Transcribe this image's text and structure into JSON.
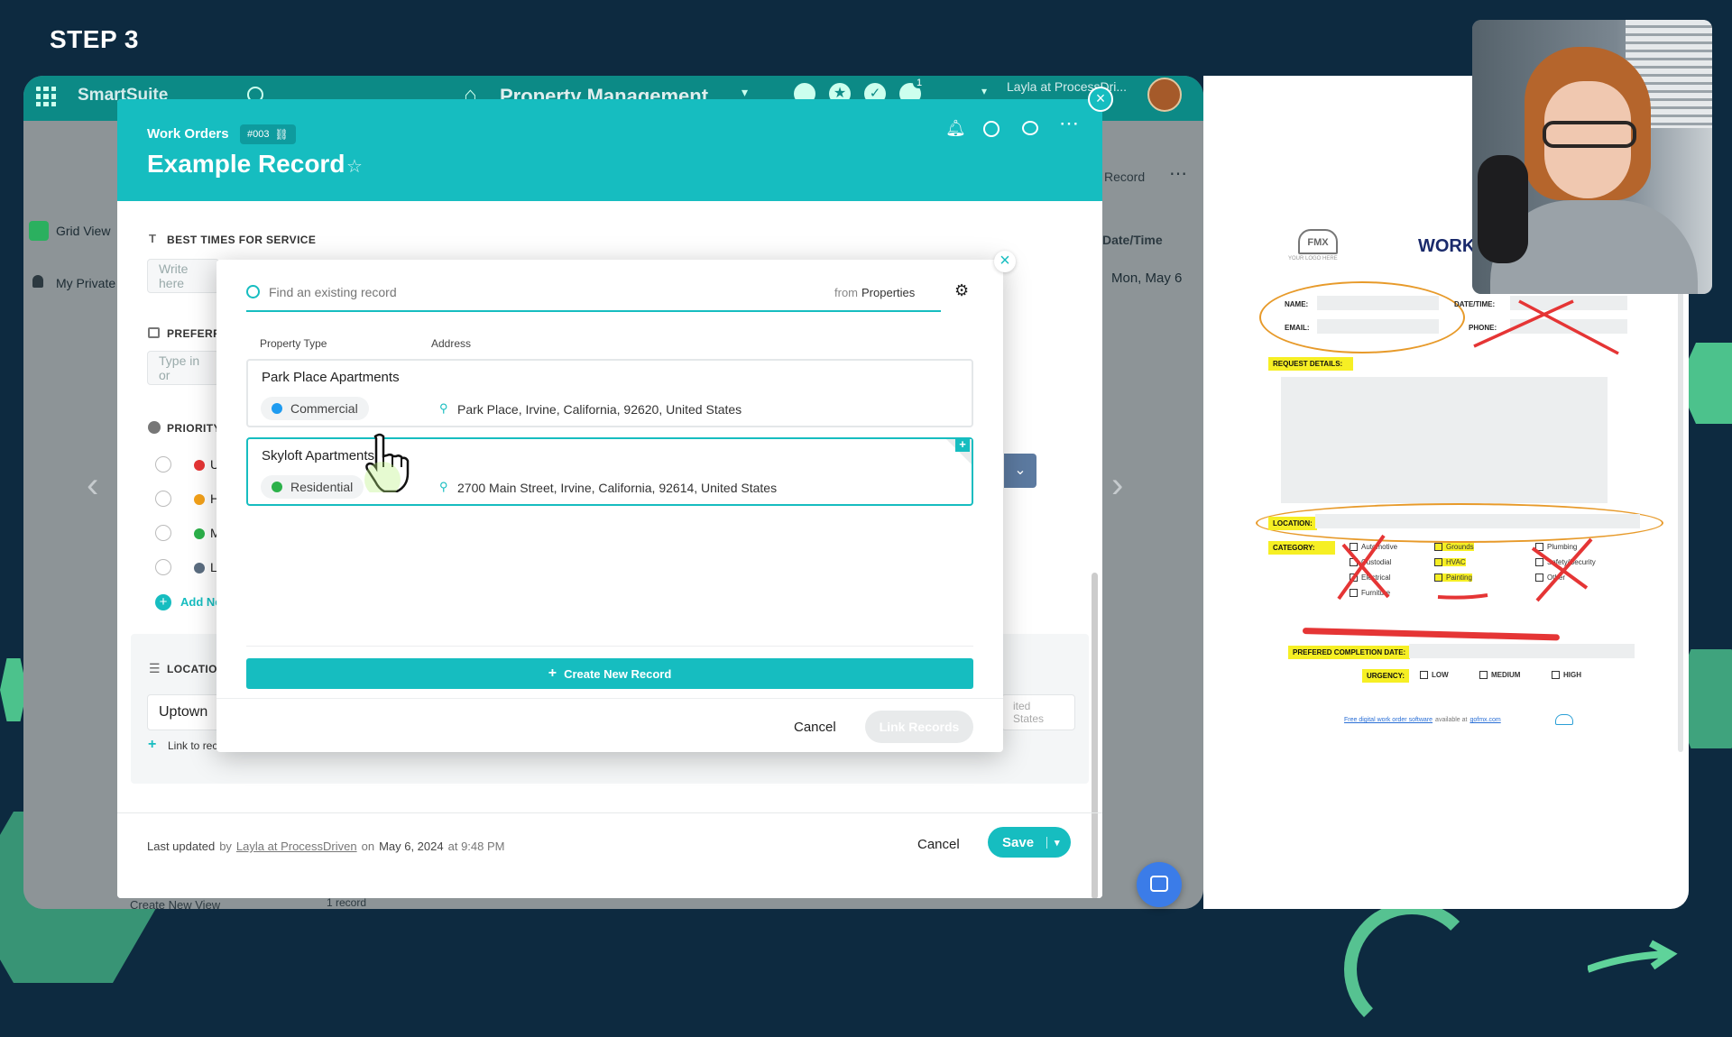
{
  "overlay": {
    "step_label": "STEP 3"
  },
  "topbar": {
    "brand": "SmartSuite",
    "workspace": "Property Management",
    "user": "Layla at ProcessDri...",
    "notification_count": "1"
  },
  "background_app": {
    "views": [
      "Grid View",
      "My Private"
    ],
    "record_label": "Record",
    "date_time_header": "Date/Time",
    "date_value": "Mon, May 6",
    "create_view": "Create New View",
    "record_count": "1 record",
    "location_suffix": "ited States"
  },
  "record": {
    "breadcrumb": "Work Orders",
    "record_id": "#003",
    "title": "Example Record",
    "fields": {
      "best_times_label": "BEST TIMES FOR SERVICE",
      "best_times_placeholder": "Write here",
      "preferred_label": "PREFERRI",
      "preferred_placeholder": "Type in or",
      "priority_label": "PRIORITY",
      "priority_options": [
        "U",
        "H",
        "M",
        "L"
      ],
      "add_new": "Add Ne",
      "location_label": "LOCATIOI",
      "location_value": "Uptown",
      "link_record": "Link to record from Properties"
    },
    "footer": {
      "last_updated_prefix": "Last updated",
      "by": "by",
      "user": "Layla at ProcessDriven",
      "on": "on",
      "date": "May 6, 2024",
      "at": "at 9:48 PM",
      "cancel": "Cancel",
      "save": "Save"
    }
  },
  "link_dialog": {
    "search_placeholder": "Find an existing record",
    "from_prefix": "from",
    "source_table": "Properties",
    "columns": [
      "Property Type",
      "Address"
    ],
    "records": [
      {
        "name": "Park Place Apartments",
        "type": "Commercial",
        "type_color": "#1e9bf0",
        "address": "Park Place, Irvine, California, 92620, United States"
      },
      {
        "name": "Skyloft Apartments",
        "type": "Residential",
        "type_color": "#2cb14a",
        "address": "2700 Main Street, Irvine, California, 92614, United States"
      }
    ],
    "create_new": "Create New Record",
    "cancel": "Cancel",
    "link_records": "Link Records"
  },
  "document": {
    "logo_text": "FMX",
    "logo_caption": "YOUR LOGO HERE",
    "title": "WORK",
    "name_label": "NAME:",
    "email_label": "EMAIL:",
    "date_time_label": "DATE/TIME:",
    "phone_label": "PHONE:",
    "request_details_label": "REQUEST DETAILS:",
    "location_label": "LOCATION:",
    "category_label": "CATEGORY:",
    "categories_col1": [
      "Automotive",
      "Custodial",
      "Electrical",
      "Furniture"
    ],
    "categories_col2": [
      "Grounds",
      "HVAC",
      "Painting"
    ],
    "categories_col3": [
      "Plumbing",
      "Safety/Security",
      "Other"
    ],
    "completion_label": "PREFERED COMPLETION DATE:",
    "urgency_label": "URGENCY:",
    "urgency_options": [
      "LOW",
      "MEDIUM",
      "HIGH"
    ],
    "footer_link": "Free digital work order software",
    "footer_mid": "available at",
    "footer_site": "gofmx.com"
  },
  "colors": {
    "teal": "#16bdc0",
    "dark_teal": "#0c8a86",
    "background": "#0d2a40",
    "green_accent": "#5fd39a",
    "highlight": "#f6ef24",
    "red_mark": "#e53535"
  }
}
